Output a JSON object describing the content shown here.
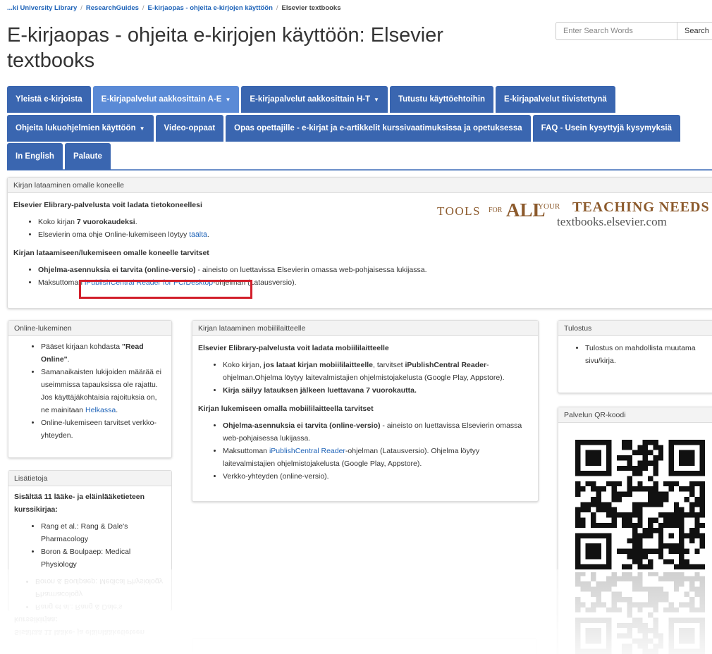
{
  "breadcrumb": [
    {
      "label": "...ki University Library"
    },
    {
      "label": "ResearchGuides"
    },
    {
      "label": "E-kirjaopas - ohjeita e-kirjojen käyttöön"
    }
  ],
  "breadcrumb_current": "Elsevier textbooks",
  "page_title": "E-kirjaopas - ohjeita e-kirjojen käyttöön: Elsevier textbooks",
  "search": {
    "placeholder": "Enter Search Words",
    "button": "Search"
  },
  "tabs_row1": [
    {
      "label": "Yleistä e-kirjoista",
      "active": false,
      "caret": ""
    },
    {
      "label": "E-kirjapalvelut aakkosittain A-E",
      "active": true,
      "caret": "▼"
    },
    {
      "label": "E-kirjapalvelut aakkosittain H-T",
      "active": false,
      "caret": "▼"
    },
    {
      "label": "Tutustu käyttöehtoihin",
      "active": false,
      "caret": ""
    },
    {
      "label": "E-kirjapalvelut tiivistettynä",
      "active": false,
      "caret": ""
    }
  ],
  "tabs_row2": [
    {
      "label": "Ohjeita lukuohjelmien käyttöön",
      "active": false,
      "caret": "▼"
    },
    {
      "label": "Video-oppaat",
      "active": false,
      "caret": ""
    },
    {
      "label": "Opas opettajille - e-kirjat ja e-artikkelit kurssivaatimuksissa ja opetuksessa",
      "active": false,
      "caret": ""
    },
    {
      "label": "FAQ - Usein kysyttyjä kysymyksiä",
      "active": false,
      "caret": ""
    }
  ],
  "tabs_row3": [
    {
      "label": "In English",
      "active": false,
      "caret": ""
    },
    {
      "label": "Palaute",
      "active": false,
      "caret": ""
    }
  ],
  "download": {
    "heading": "Kirjan lataaminen omalle koneelle",
    "intro": "Elsevier Elibrary-palvelusta voit ladata tietokoneellesi",
    "item1_pre": "Koko kirjan ",
    "item1_bold": "7 vuorokaudeksi",
    "item1_post": ".",
    "item2_pre": "Elsevierin oma ohje Online-lukemiseen löytyy ",
    "item2_link": "täältä",
    "item2_post": ".",
    "needs": "Kirjan lataamiseen/lukemiseen omalle koneelle tarvitset",
    "item3_bold": "Ohjelma-asennuksia ei tarvita (online-versio)",
    "item3_post": " - aineisto on luettavissa Elsevierin omassa web-pohjaisessa lukijassa.",
    "item4_pre": "Maksuttoman ",
    "item4_link": "iPublishCentral Reader for PC/Desktop",
    "item4_post": "-ohjelman (Latausversio)."
  },
  "banner": {
    "tools": "TOOLS",
    "for": "FOR",
    "all": "ALL",
    "your": "YOUR",
    "teaching": "TEACHING NEEDS",
    "url": "textbooks.elsevier.com"
  },
  "online": {
    "heading": "Online-lukeminen",
    "item1_pre": "Pääset kirjaan kohdasta ",
    "item1_bold": "\"Read Online\"",
    "item1_post": ".",
    "item2_pre": "Samanaikaisten lukijoiden määrää ei useimmissa tapauksissa ole rajattu. Jos käyttäjäkohtaisia rajoituksia on, ne mainitaan ",
    "item2_link": "Helkassa",
    "item2_post": ".",
    "item3": "Online-lukemiseen tarvitset verkko-yhteyden."
  },
  "mobile": {
    "heading": "Kirjan lataaminen mobiililaitteelle",
    "intro": "Elsevier Elibrary-palvelusta voit ladata mobiililaitteelle",
    "item1_pre": "Koko kirjan, ",
    "item1_bold1": "jos lataat kirjan mobiililaitteelle",
    "item1_mid": ", tarvitset ",
    "item1_bold2": "iPublishCentral Reader",
    "item1_post": "-ohjelman.Ohjelma löytyy laitevalmistajien ohjelmistojakelusta (Google Play, Appstore).",
    "item2_bold": "Kirja säilyy latauksen jälkeen luettavana 7 vuorokautta.",
    "needs": "Kirjan lukemiseen omalla mobiililaitteella tarvitset",
    "item3_bold": "Ohjelma-asennuksia ei tarvita (online-versio)",
    "item3_post": " - aineisto on luettavissa Elsevierin omassa web-pohjaisessa lukijassa.",
    "item4_pre": "Maksuttoman ",
    "item4_link": "iPublishCentral Reader",
    "item4_post": "-ohjelman (Latausversio). Ohjelma löytyy laitevalmistajien ohjelmistojakelusta (Google Play, Appstore).",
    "item5": "Verkko-yhteyden (online-versio)."
  },
  "print": {
    "heading": "Tulostus",
    "item1": "Tulostus on mahdollista muutama sivu/kirja."
  },
  "qr": {
    "heading": "Palvelun QR-koodi"
  },
  "more": {
    "heading": "Lisätietoja",
    "intro": "Sisältää 11 lääke- ja eläinlääketieteen kurssikirjaa:",
    "item1": "Rang et al.: Rang & Dale's Pharmacology",
    "item2": "Boron & Boulpaep: Medical Physiology"
  },
  "colors": {
    "tab": "#3a66b0",
    "tab_active": "#5a8ad6",
    "link": "#1e63b8",
    "highlight": "#d21f2b",
    "banner": "#8c5a2c"
  }
}
